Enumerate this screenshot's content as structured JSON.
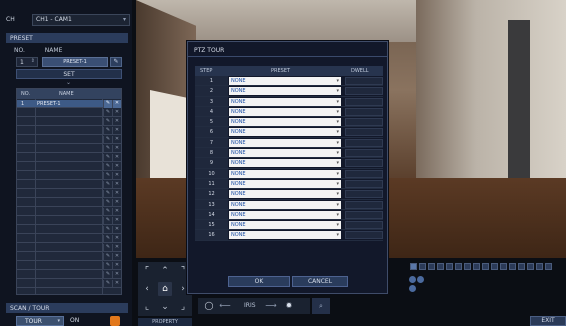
{
  "channel": {
    "label": "CH",
    "value": "CH1 - CAM1"
  },
  "preset": {
    "section_title": "PRESET",
    "no_label": "NO.",
    "name_label": "NAME",
    "number": "1",
    "name": "PRESET-1",
    "set_label": "SET",
    "list": {
      "col_no": "NO.",
      "col_name": "NAME",
      "rows": [
        {
          "no": "1",
          "name": "PRESET-1"
        }
      ]
    }
  },
  "scan_tour": {
    "section_title": "SCAN / TOUR",
    "mode": "TOUR",
    "state_label": "ON"
  },
  "property_label": "PROPERTY",
  "iris_label": "IRIS",
  "exit_label": "EXIT",
  "dialog": {
    "title": "PTZ TOUR",
    "col_step": "STEP",
    "col_preset": "PRESET",
    "col_dwell": "DWELL",
    "rows": [
      {
        "step": "1",
        "preset": "NONE"
      },
      {
        "step": "2",
        "preset": "NONE"
      },
      {
        "step": "3",
        "preset": "NONE"
      },
      {
        "step": "4",
        "preset": "NONE"
      },
      {
        "step": "5",
        "preset": "NONE"
      },
      {
        "step": "6",
        "preset": "NONE"
      },
      {
        "step": "7",
        "preset": "NONE"
      },
      {
        "step": "8",
        "preset": "NONE"
      },
      {
        "step": "9",
        "preset": "NONE"
      },
      {
        "step": "10",
        "preset": "NONE"
      },
      {
        "step": "11",
        "preset": "NONE"
      },
      {
        "step": "12",
        "preset": "NONE"
      },
      {
        "step": "13",
        "preset": "NONE"
      },
      {
        "step": "14",
        "preset": "NONE"
      },
      {
        "step": "15",
        "preset": "NONE"
      },
      {
        "step": "16",
        "preset": "NONE"
      }
    ],
    "ok_label": "OK",
    "cancel_label": "CANCEL"
  },
  "colors": {
    "accent": "#e2781c",
    "header": "#2b3c5c",
    "selected_row": "#3d5a86"
  },
  "icons": {
    "pan_up": "chevron-up-icon",
    "pan_down": "chevron-down-icon",
    "pan_left": "chevron-left-icon",
    "pan_right": "chevron-right-icon",
    "home": "home-icon",
    "edit": "pencil-icon",
    "delete": "close-icon",
    "iris_close": "iris-close-icon",
    "iris_open": "iris-open-icon"
  }
}
